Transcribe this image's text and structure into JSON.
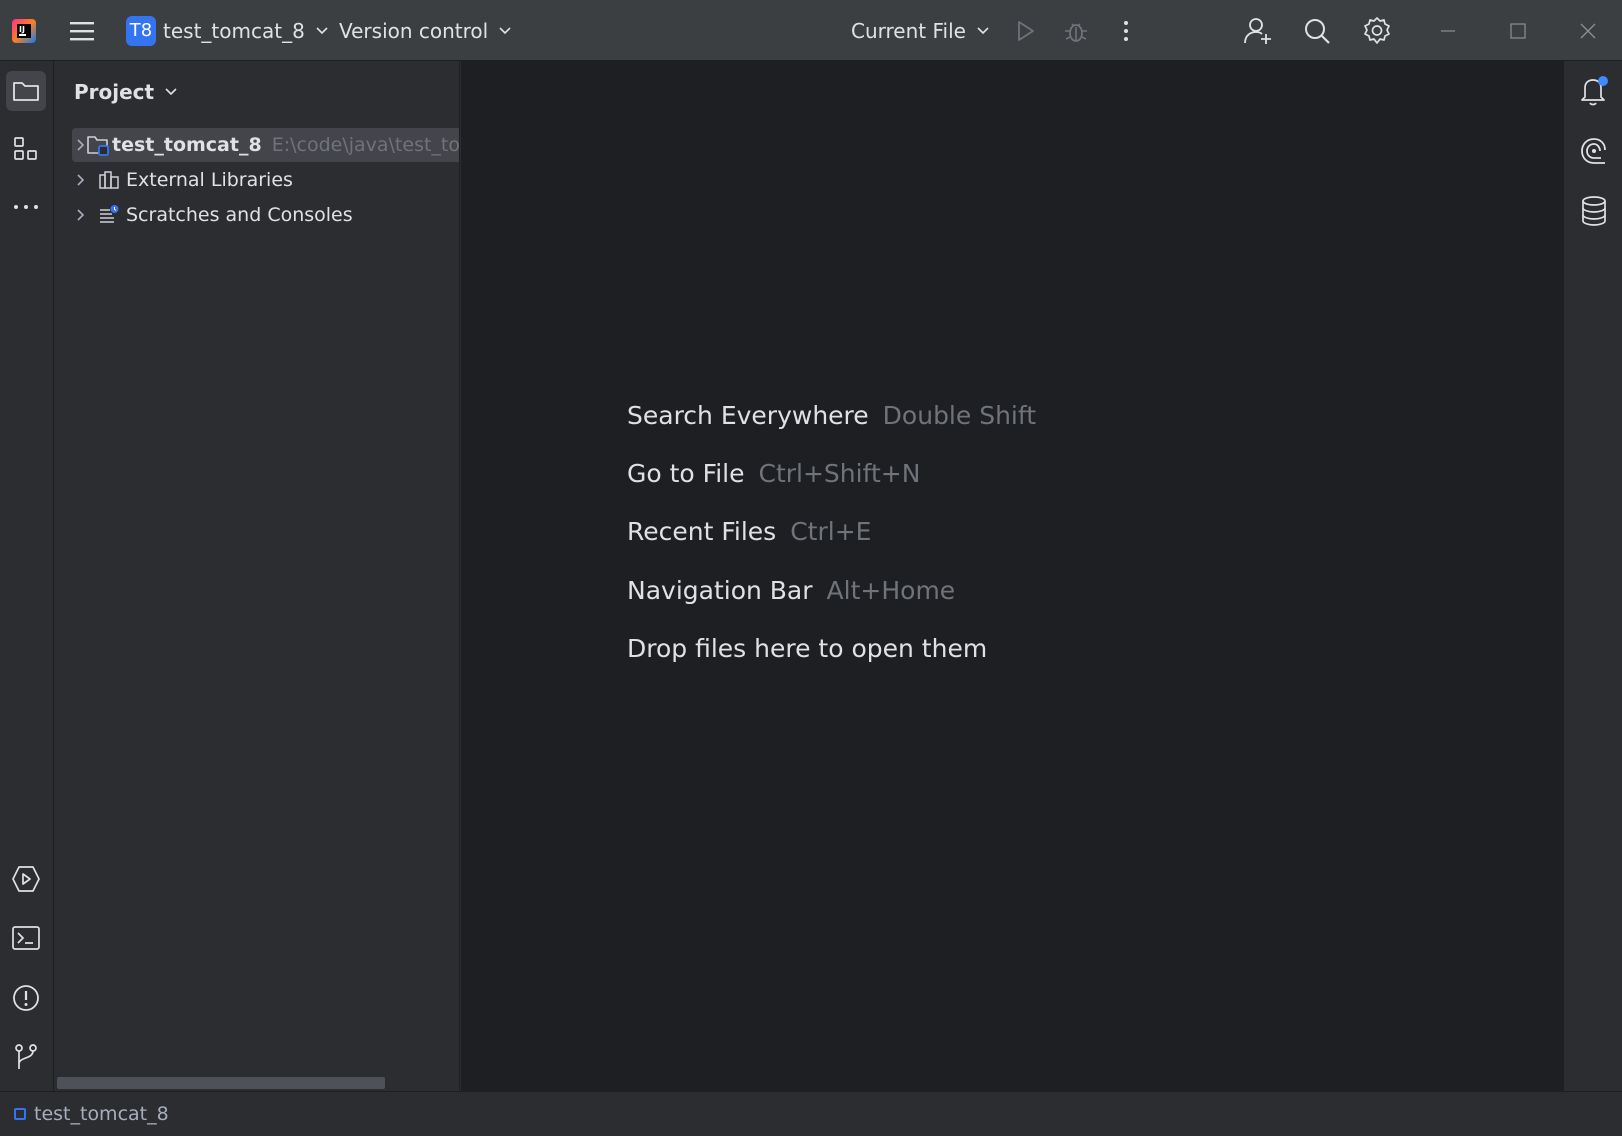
{
  "titlebar": {
    "project_badge": "T8",
    "project_name": "test_tomcat_8",
    "vcs_label": "Version control",
    "run_config_label": "Current File"
  },
  "project_panel": {
    "title": "Project",
    "tree": [
      {
        "label": "test_tomcat_8",
        "path": "E:\\code\\java\\test_to",
        "icon": "module-folder-icon",
        "selected": true
      },
      {
        "label": "External Libraries",
        "icon": "library-icon"
      },
      {
        "label": "Scratches and Consoles",
        "icon": "scratches-icon"
      }
    ]
  },
  "editor": {
    "hints": [
      {
        "action": "Search Everywhere",
        "shortcut": "Double Shift"
      },
      {
        "action": "Go to File",
        "shortcut": "Ctrl+Shift+N"
      },
      {
        "action": "Recent Files",
        "shortcut": "Ctrl+E"
      },
      {
        "action": "Navigation Bar",
        "shortcut": "Alt+Home"
      },
      {
        "action": "Drop files here to open them",
        "shortcut": ""
      }
    ]
  },
  "statusbar": {
    "breadcrumb": "test_tomcat_8"
  },
  "colors": {
    "accent": "#3574f0",
    "notification_dot": "#3d8bff",
    "titlebar_bg": "#3c3f41",
    "editor_bg": "#1e1f22",
    "panel_bg": "#2b2d30"
  }
}
